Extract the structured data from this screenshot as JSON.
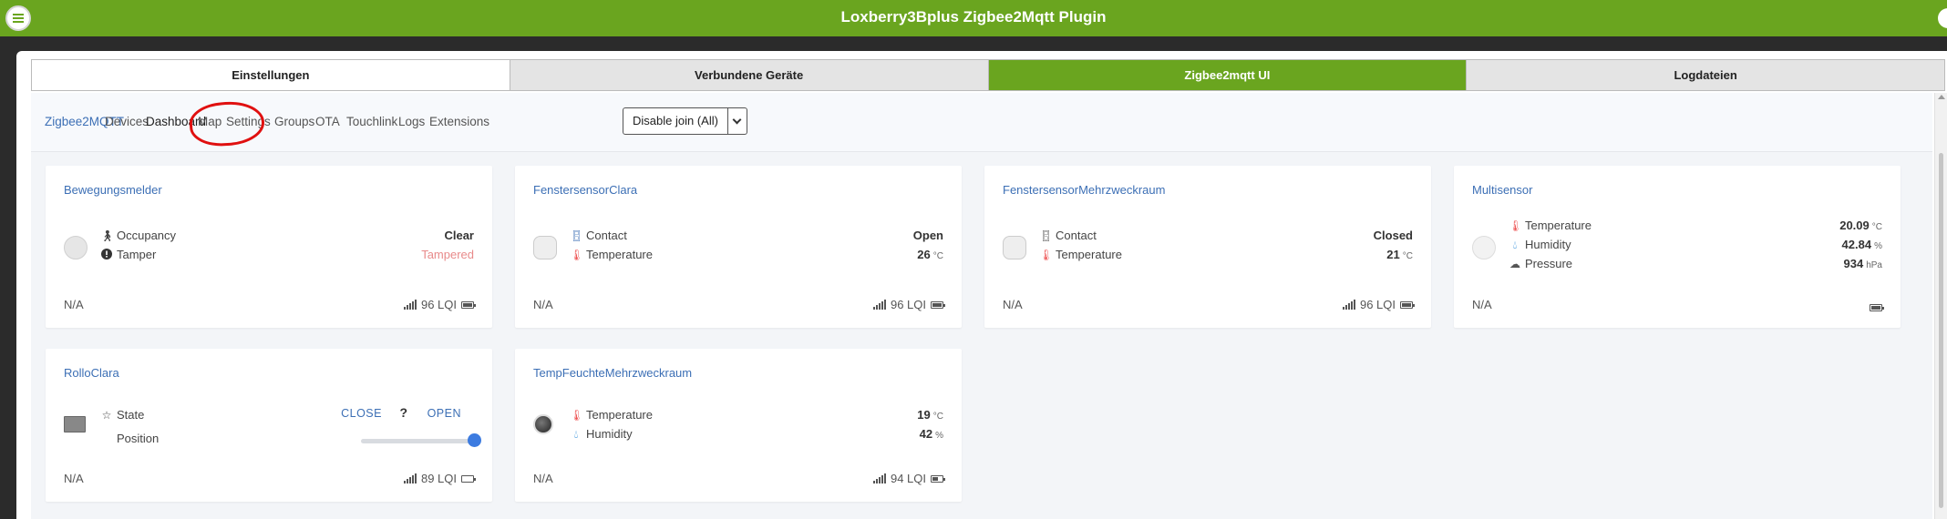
{
  "app": {
    "title": "Loxberry3Bplus Zigbee2Mqtt Plugin"
  },
  "tabs": [
    {
      "label": "Einstellungen"
    },
    {
      "label": "Verbundene Geräte"
    },
    {
      "label": "Zigbee2mqtt UI"
    },
    {
      "label": "Logdateien"
    }
  ],
  "nav": {
    "brand": "Zigbee2MQTT",
    "items": [
      "Devices",
      "Dashboard",
      "Map",
      "Settings",
      "Groups",
      "OTA",
      "Touchlink",
      "Logs",
      "Extensions"
    ],
    "join_button": "Disable join (All)"
  },
  "colors": {
    "accent_green": "#6aa51f",
    "link_blue": "#3c6fb5",
    "annotation_red": "#e01010"
  },
  "cards": [
    {
      "name": "Bewegungsmelder",
      "rows": [
        {
          "icon": "walking-icon",
          "label": "Occupancy",
          "value": "Clear",
          "unit": ""
        },
        {
          "icon": "alert-icon",
          "label": "Tamper",
          "value": "Tampered",
          "unit": ""
        }
      ],
      "footer_left": "N/A",
      "lqi": "96 LQI",
      "battery": "full"
    },
    {
      "name": "FenstersensorClara",
      "rows": [
        {
          "icon": "door-open-icon",
          "label": "Contact",
          "value": "Open",
          "unit": ""
        },
        {
          "icon": "thermometer-icon",
          "label": "Temperature",
          "value": "26",
          "unit": "°C"
        }
      ],
      "footer_left": "N/A",
      "lqi": "96 LQI",
      "battery": "full"
    },
    {
      "name": "FenstersensorMehrzweckraum",
      "rows": [
        {
          "icon": "door-closed-icon",
          "label": "Contact",
          "value": "Closed",
          "unit": ""
        },
        {
          "icon": "thermometer-icon",
          "label": "Temperature",
          "value": "21",
          "unit": "°C"
        }
      ],
      "footer_left": "N/A",
      "lqi": "96 LQI",
      "battery": "full"
    },
    {
      "name": "Multisensor",
      "rows": [
        {
          "icon": "thermometer-icon",
          "label": "Temperature",
          "value": "20.09",
          "unit": "°C"
        },
        {
          "icon": "droplet-icon",
          "label": "Humidity",
          "value": "42.84",
          "unit": "%"
        },
        {
          "icon": "cloud-icon",
          "label": "Pressure",
          "value": "934",
          "unit": "hPa"
        }
      ],
      "footer_left": "N/A",
      "lqi": "",
      "battery": "full"
    },
    {
      "name": "RolloClara",
      "state_label": "State",
      "position_label": "Position",
      "close_label": "CLOSE",
      "unknown_label": "?",
      "open_label": "OPEN",
      "position_value": 100,
      "footer_left": "N/A",
      "lqi": "89 LQI",
      "battery": "empty"
    },
    {
      "name": "TempFeuchteMehrzweckraum",
      "rows": [
        {
          "icon": "thermometer-icon",
          "label": "Temperature",
          "value": "19",
          "unit": "°C"
        },
        {
          "icon": "droplet-icon",
          "label": "Humidity",
          "value": "42",
          "unit": "%"
        }
      ],
      "footer_left": "N/A",
      "lqi": "94 LQI",
      "battery": "half"
    }
  ]
}
